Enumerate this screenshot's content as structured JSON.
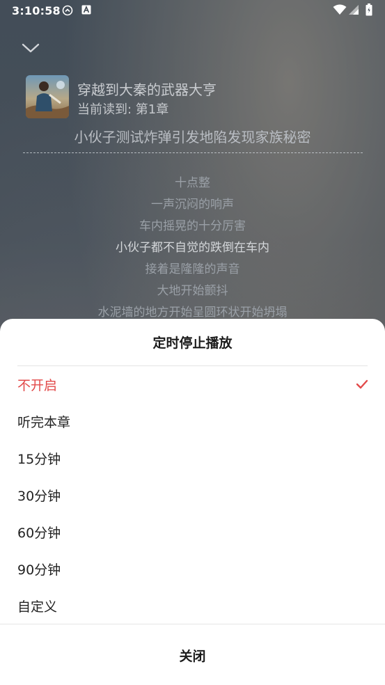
{
  "status_bar": {
    "time": "3:10:58",
    "icons": [
      "media-sync-icon",
      "a-badge-icon",
      "wifi-icon",
      "signal-icon",
      "battery-icon"
    ]
  },
  "player": {
    "collapse_icon": "chevron-down-icon",
    "book_title": "穿越到大秦的武器大亨",
    "progress": "当前读到: 第1章",
    "chapter_title": "小伙子测试炸弹引发地陷发现家族秘密",
    "lyrics": [
      "十点整",
      "一声沉闷的响声",
      "车内摇晃的十分厉害",
      "小伙子都不自觉的跌倒在车内",
      "接着是隆隆的声音",
      "大地开始颤抖",
      "水泥墙的地方开始呈圆环状开始坍塌"
    ],
    "current_lyric_index": 3
  },
  "sheet": {
    "title": "定时停止播放",
    "options": [
      {
        "label": "不开启",
        "selected": true
      },
      {
        "label": "听完本章",
        "selected": false
      },
      {
        "label": "15分钟",
        "selected": false
      },
      {
        "label": "30分钟",
        "selected": false
      },
      {
        "label": "60分钟",
        "selected": false
      },
      {
        "label": "90分钟",
        "selected": false
      },
      {
        "label": "自定义",
        "selected": false
      }
    ],
    "close_label": "关闭"
  },
  "colors": {
    "accent": "#e24a4a",
    "sheet_background": "#ffffff",
    "text_primary": "#222222"
  }
}
